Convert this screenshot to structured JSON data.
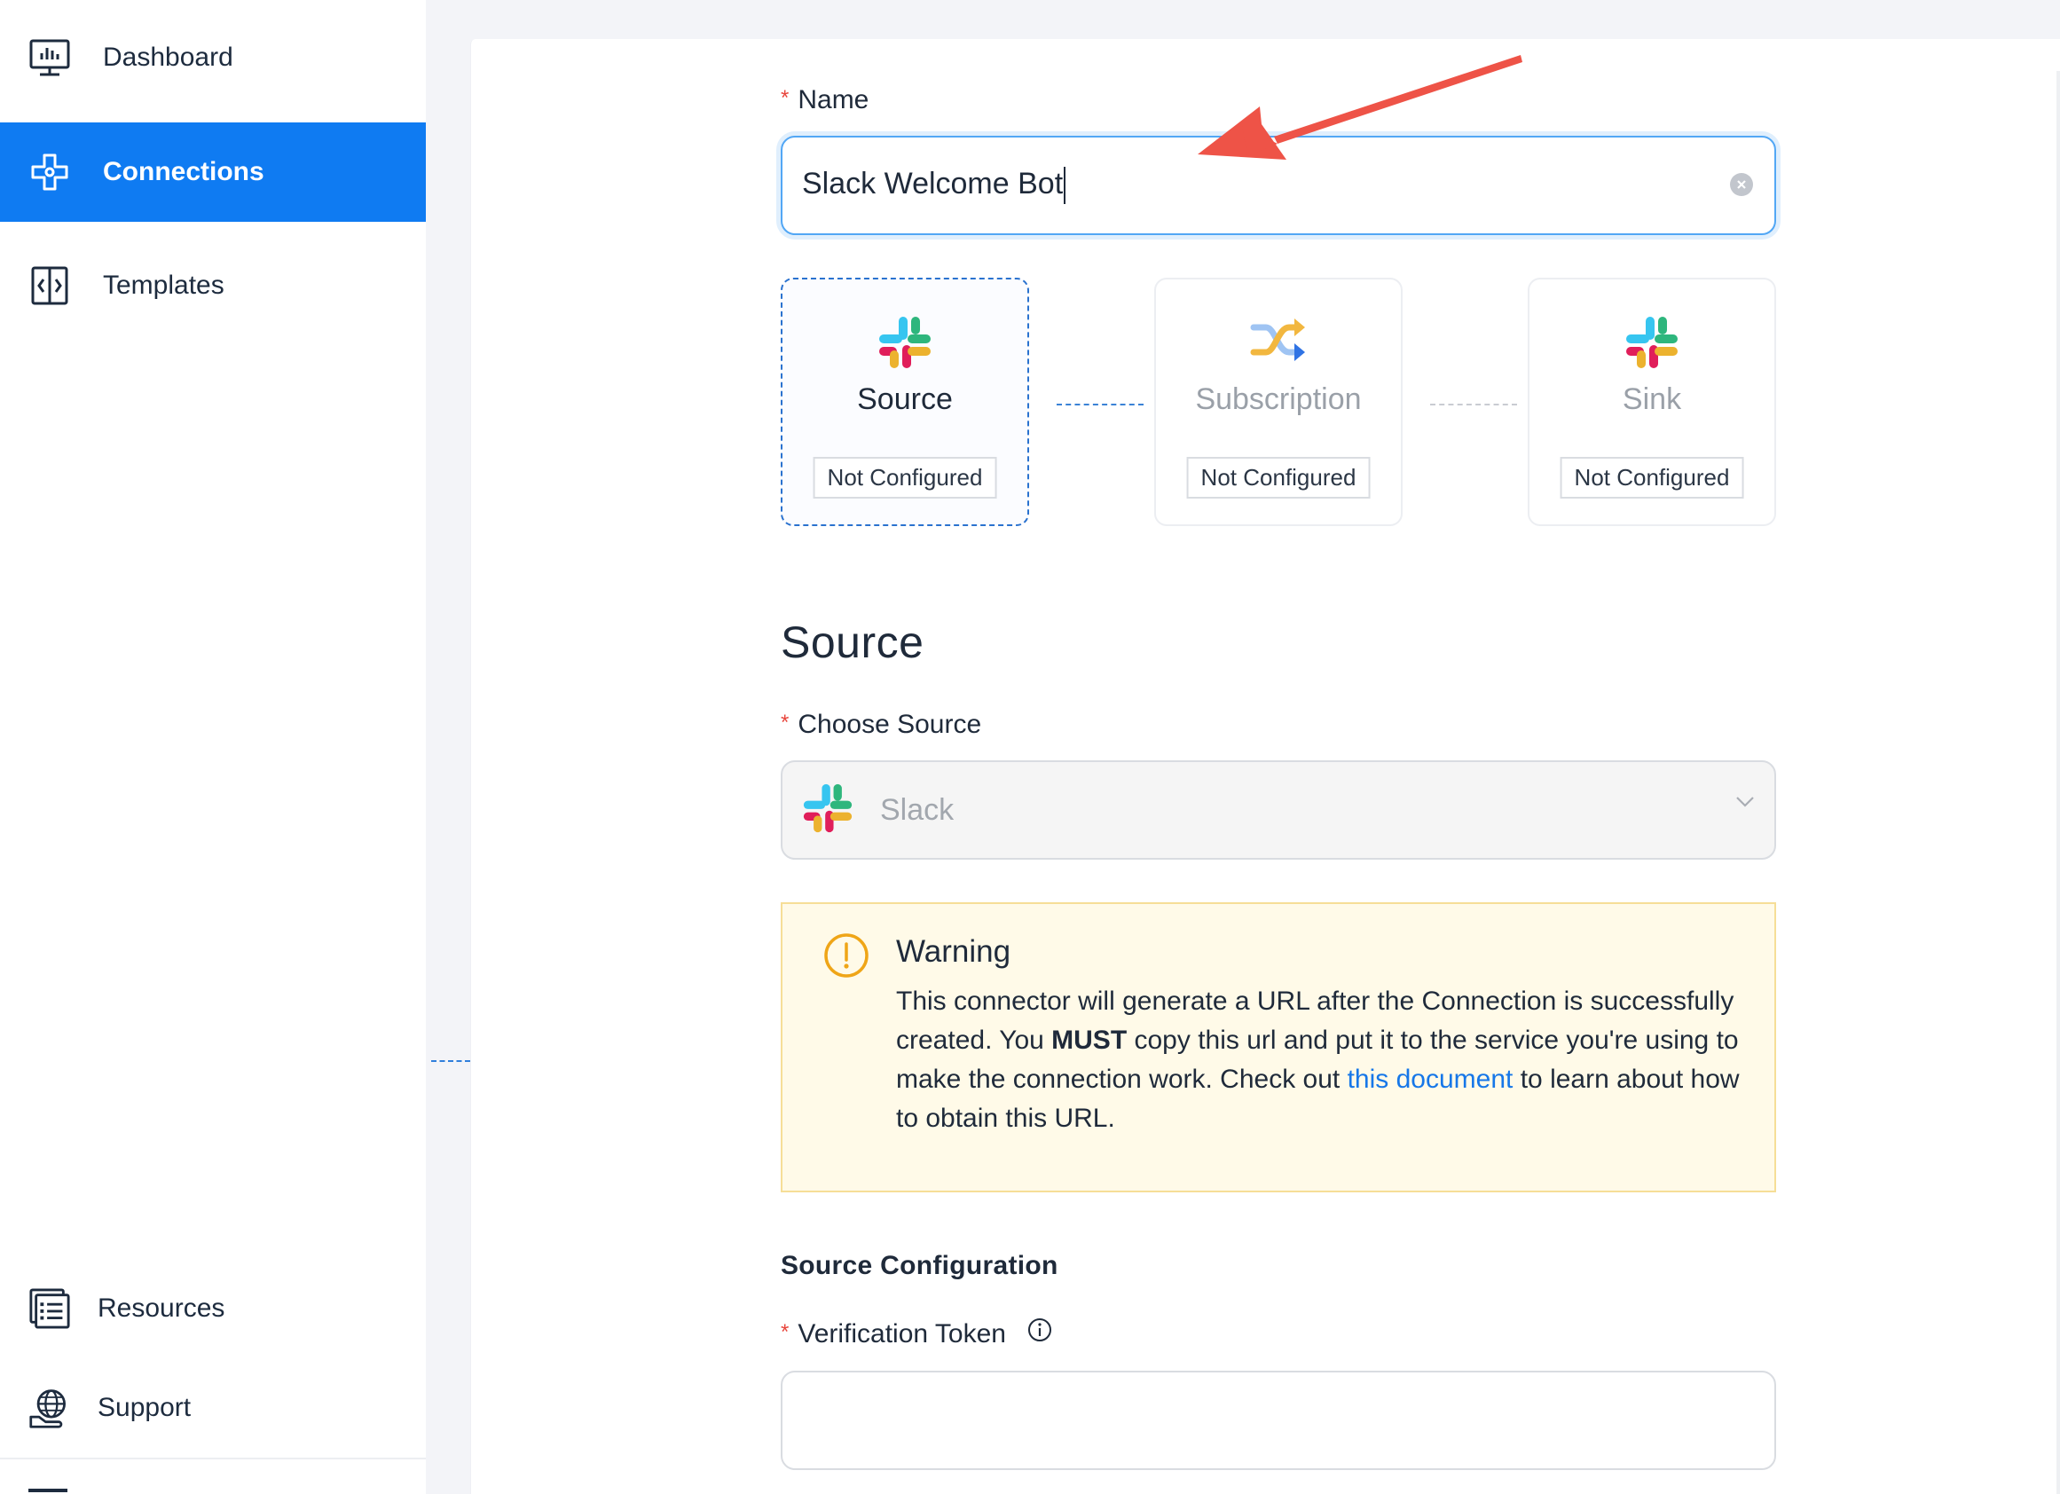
{
  "sidebar": {
    "items": [
      {
        "label": "Dashboard",
        "icon": "dashboard-icon"
      },
      {
        "label": "Connections",
        "icon": "connections-icon",
        "active": true
      },
      {
        "label": "Templates",
        "icon": "templates-icon"
      }
    ],
    "bottom_items": [
      {
        "label": "Resources",
        "icon": "resources-icon"
      },
      {
        "label": "Support",
        "icon": "support-icon"
      }
    ]
  },
  "form": {
    "name_label": "Name",
    "name_value": "Slack Welcome Bot",
    "steps": [
      {
        "title": "Source",
        "status": "Not Configured",
        "icon": "slack-icon",
        "active": true
      },
      {
        "title": "Subscription",
        "status": "Not Configured",
        "icon": "shuffle-icon",
        "active": false
      },
      {
        "title": "Sink",
        "status": "Not Configured",
        "icon": "slack-icon",
        "active": false
      }
    ],
    "section_title": "Source",
    "choose_source_label": "Choose Source",
    "choose_source_value": "Slack",
    "warning": {
      "title": "Warning",
      "text_1": "This connector will generate a URL after the Connection is successfully created. You ",
      "text_bold": "MUST",
      "text_2": " copy this url and put it to the service you're using to make the connection work. Check out ",
      "link": "this document",
      "text_3": " to learn about how to obtain this URL."
    },
    "config_title": "Source Configuration",
    "token_label": "Verification Token",
    "token_value": ""
  },
  "colors": {
    "accent": "#0f7bf2",
    "required": "#e8453c",
    "warning_bg": "#fffae8",
    "warning_border": "#f6de97",
    "link": "#1677e8",
    "annotation_arrow": "#ee5347"
  }
}
